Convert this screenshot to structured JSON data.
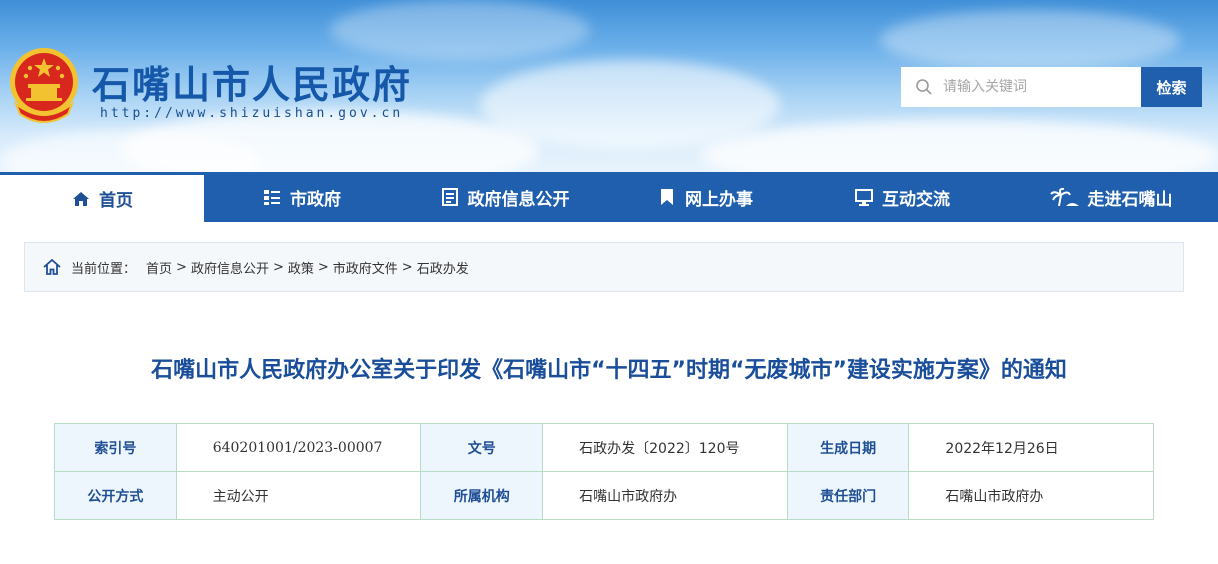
{
  "header": {
    "site_title": "石嘴山市人民政府",
    "site_url": "http://www.shizuishan.gov.cn",
    "search_placeholder": "请输入关键词",
    "search_button": "检索"
  },
  "nav": {
    "items": [
      {
        "label": "首页",
        "icon": "home-icon",
        "active": true
      },
      {
        "label": "市政府",
        "icon": "list-icon"
      },
      {
        "label": "政府信息公开",
        "icon": "document-icon"
      },
      {
        "label": "网上办事",
        "icon": "bookmark-icon"
      },
      {
        "label": "互动交流",
        "icon": "monitor-icon"
      },
      {
        "label": "走进石嘴山",
        "icon": "palm-tree-icon"
      }
    ]
  },
  "breadcrumb": {
    "prefix": "当前位置：",
    "items": [
      "首页",
      "政府信息公开",
      "政策",
      "市政府文件",
      "石政办发"
    ],
    "separator": ">"
  },
  "document": {
    "title": "石嘴山市人民政府办公室关于印发《石嘴山市“十四五”时期“无废城市”建设实施方案》的通知"
  },
  "meta": {
    "row1": {
      "k1": "索引号",
      "v1": "640201001/2023-00007",
      "k2": "文号",
      "v2": "石政办发〔2022〕120号",
      "k3": "生成日期",
      "v3": "2022年12月26日"
    },
    "row2": {
      "k1": "公开方式",
      "v1": "主动公开",
      "k2": "所属机构",
      "v2": "石嘴山市政府办",
      "k3": "责任部门",
      "v3": "石嘴山市政府办"
    }
  },
  "colors": {
    "primary_blue": "#1f5fae",
    "title_blue": "#1a4e9a",
    "emblem_red": "#d8281e",
    "emblem_gold": "#f2c230"
  }
}
